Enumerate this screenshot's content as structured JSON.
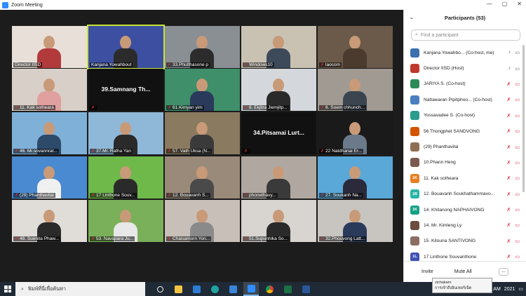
{
  "window": {
    "title": "Zoom Meeting",
    "controls": [
      "—",
      "▢",
      "✕"
    ]
  },
  "participants_panel": {
    "title": "Participants (53)",
    "search_placeholder": "Find a participant",
    "list": [
      {
        "name": "Kanjana Yowahbo... (Co-host, me)",
        "avatar": "",
        "avatar_color": "#3a6fb0",
        "mic": "on",
        "cam": "on"
      },
      {
        "name": "Director IISD (Host)",
        "avatar": "",
        "avatar_color": "#c0392b",
        "mic": "on",
        "cam": "on"
      },
      {
        "name": "JARIYA S. (Co-host)",
        "avatar": "",
        "avatar_color": "#2e8b57",
        "mic": "off",
        "cam": "off"
      },
      {
        "name": "Nattawaran Pipitphoo... (Co-host)",
        "avatar": "",
        "avatar_color": "#4a7fbf",
        "mic": "off",
        "cam": "off"
      },
      {
        "name": "Yossavadee S. (Co-host)",
        "avatar": "",
        "avatar_color": "#2a9d8f",
        "mic": "off",
        "cam": "off"
      },
      {
        "name": "56 Thongphet SANDVONG",
        "avatar": "",
        "avatar_color": "#d35400",
        "mic": "off",
        "cam": "off"
      },
      {
        "name": "(29) Phanthavilai",
        "avatar": "",
        "avatar_color": "#8e6e53",
        "mic": "off",
        "cam": "off"
      },
      {
        "name": "10.Phann Heng",
        "avatar": "",
        "avatar_color": "#7d5a4f",
        "mic": "off",
        "cam": "off"
      },
      {
        "name": "11. Kak sotheara",
        "avatar": "1K",
        "avatar_color": "#e67e22",
        "mic": "off",
        "cam": "off"
      },
      {
        "name": "12. Bouavanh Soukhathammavo...",
        "avatar": "1B",
        "avatar_color": "#2ab3a6",
        "mic": "off",
        "cam": "off"
      },
      {
        "name": "14. Khitanong NAPHAIVONG",
        "avatar": "1K",
        "avatar_color": "#16a085",
        "mic": "off",
        "cam": "off"
      },
      {
        "name": "14. Mr. Kimleng Ly",
        "avatar": "",
        "avatar_color": "#6d4c41",
        "mic": "off",
        "cam": "off"
      },
      {
        "name": "15. Kitouna SANTIVONG",
        "avatar": "",
        "avatar_color": "#8d6e63",
        "mic": "off",
        "cam": "off"
      },
      {
        "name": "17 Linthone Souvanthone",
        "avatar": "1L",
        "avatar_color": "#3f51b5",
        "mic": "off",
        "cam": "off"
      }
    ],
    "invite_label": "Invite",
    "mute_all_label": "Mute All",
    "more_label": "..."
  },
  "gallery": [
    {
      "name": "Director IISD",
      "muted": false,
      "bg": "#e8e0d8",
      "shirt": "#b23a3a",
      "text": ""
    },
    {
      "name": "Kanjana Yowahbout",
      "muted": false,
      "bg": "#3c4fa0",
      "shirt": "#2b2b2b",
      "text": "",
      "active": true
    },
    {
      "name": "33.Phutthasone p",
      "muted": true,
      "bg": "#8a8f94",
      "shirt": "#2c2c2c",
      "text": ""
    },
    {
      "name": "Windows10",
      "muted": true,
      "bg": "#c9c1b2",
      "shirt": "#3d4a5a",
      "text": ""
    },
    {
      "name": "laocom",
      "muted": true,
      "bg": "#6b5a4a",
      "shirt": "#4a3b2e",
      "text": ""
    },
    {
      "name": "11. Kak sotheara",
      "muted": true,
      "bg": "#d8d0c8",
      "shirt": "#e0a0a0",
      "text": ""
    },
    {
      "name": "",
      "muted": true,
      "bg": "#111111",
      "shirt": "",
      "text": "39.Samnang  Th..."
    },
    {
      "name": "61.Kimyan yim",
      "muted": true,
      "bg": "#3e8f6a",
      "shirt": "#2a3a5a",
      "text": ""
    },
    {
      "name": "8. Ekjitra Jiemjitp...",
      "muted": true,
      "bg": "#d4d8dc",
      "shirt": "#2a2a2a",
      "text": ""
    },
    {
      "name": "6. Soem chhunch...",
      "muted": true,
      "bg": "#a09a92",
      "shirt": "#3a4550",
      "text": ""
    },
    {
      "name": "46. Mr.sovannrat...",
      "muted": true,
      "bg": "#7fb0d8",
      "shirt": "#2d4a6a",
      "text": ""
    },
    {
      "name": "37.Mr. Ratha Yan",
      "muted": true,
      "bg": "#8fb8d8",
      "shirt": "#2a2a2a",
      "text": ""
    },
    {
      "name": "57. Vath Uksa (N...",
      "muted": true,
      "bg": "#8a7a60",
      "shirt": "#3a3a3a",
      "text": ""
    },
    {
      "name": "",
      "muted": true,
      "bg": "#111111",
      "shirt": "",
      "text": "34.Pitsamai  Lurt..."
    },
    {
      "name": "22 Natdhanai  Er...",
      "muted": true,
      "bg": "#1a1a1a",
      "shirt": "#6a7a8a",
      "text": ""
    },
    {
      "name": "(29) Phanthavilai",
      "muted": true,
      "bg": "#4a8ad0",
      "shirt": "#f0f0f0",
      "text": ""
    },
    {
      "name": "17 Linthone Souv...",
      "muted": true,
      "bg": "#6fb84a",
      "shirt": "#2a2a2a",
      "text": ""
    },
    {
      "name": "12. Bouavanh S...",
      "muted": true,
      "bg": "#9a8a7a",
      "shirt": "#4a4a4a",
      "text": ""
    },
    {
      "name": "phonethavy...",
      "muted": true,
      "bg": "#b0a8a0",
      "shirt": "#3a3a3a",
      "text": ""
    },
    {
      "name": "27. Soukanh Na...",
      "muted": true,
      "bg": "#5aa8d8",
      "shirt": "#2a2a3a",
      "text": ""
    },
    {
      "name": "48. Suenita Phaw...",
      "muted": true,
      "bg": "#e0dcd8",
      "shirt": "#2a2a2a",
      "text": ""
    },
    {
      "name": "53. Navapara Ju...",
      "muted": true,
      "bg": "#7ab05a",
      "shirt": "#e8e8e8",
      "text": ""
    },
    {
      "name": "Chaisamorn Yon...",
      "muted": true,
      "bg": "#c8c0b8",
      "shirt": "#8a8a8a",
      "text": ""
    },
    {
      "name": "51.Supunhika So...",
      "muted": true,
      "bg": "#d8d4d0",
      "shirt": "#2a2a2a",
      "text": ""
    },
    {
      "name": "32.Phouvong Latt...",
      "muted": true,
      "bg": "#c8c4c0",
      "shirt": "#2a3a5a",
      "text": ""
    }
  ],
  "taskbar": {
    "search_placeholder": "พิมพ์ที่นี่เพื่อค้นหา",
    "apps": [
      "task-view",
      "file-explorer",
      "mail",
      "edge",
      "store",
      "zoom",
      "chrome",
      "excel",
      "word"
    ],
    "time": "AM",
    "date": "2021"
  },
  "tooltip": {
    "line1": "vichakarn",
    "line2": "การเข้าถึงอินเทอร์เน็ต"
  }
}
